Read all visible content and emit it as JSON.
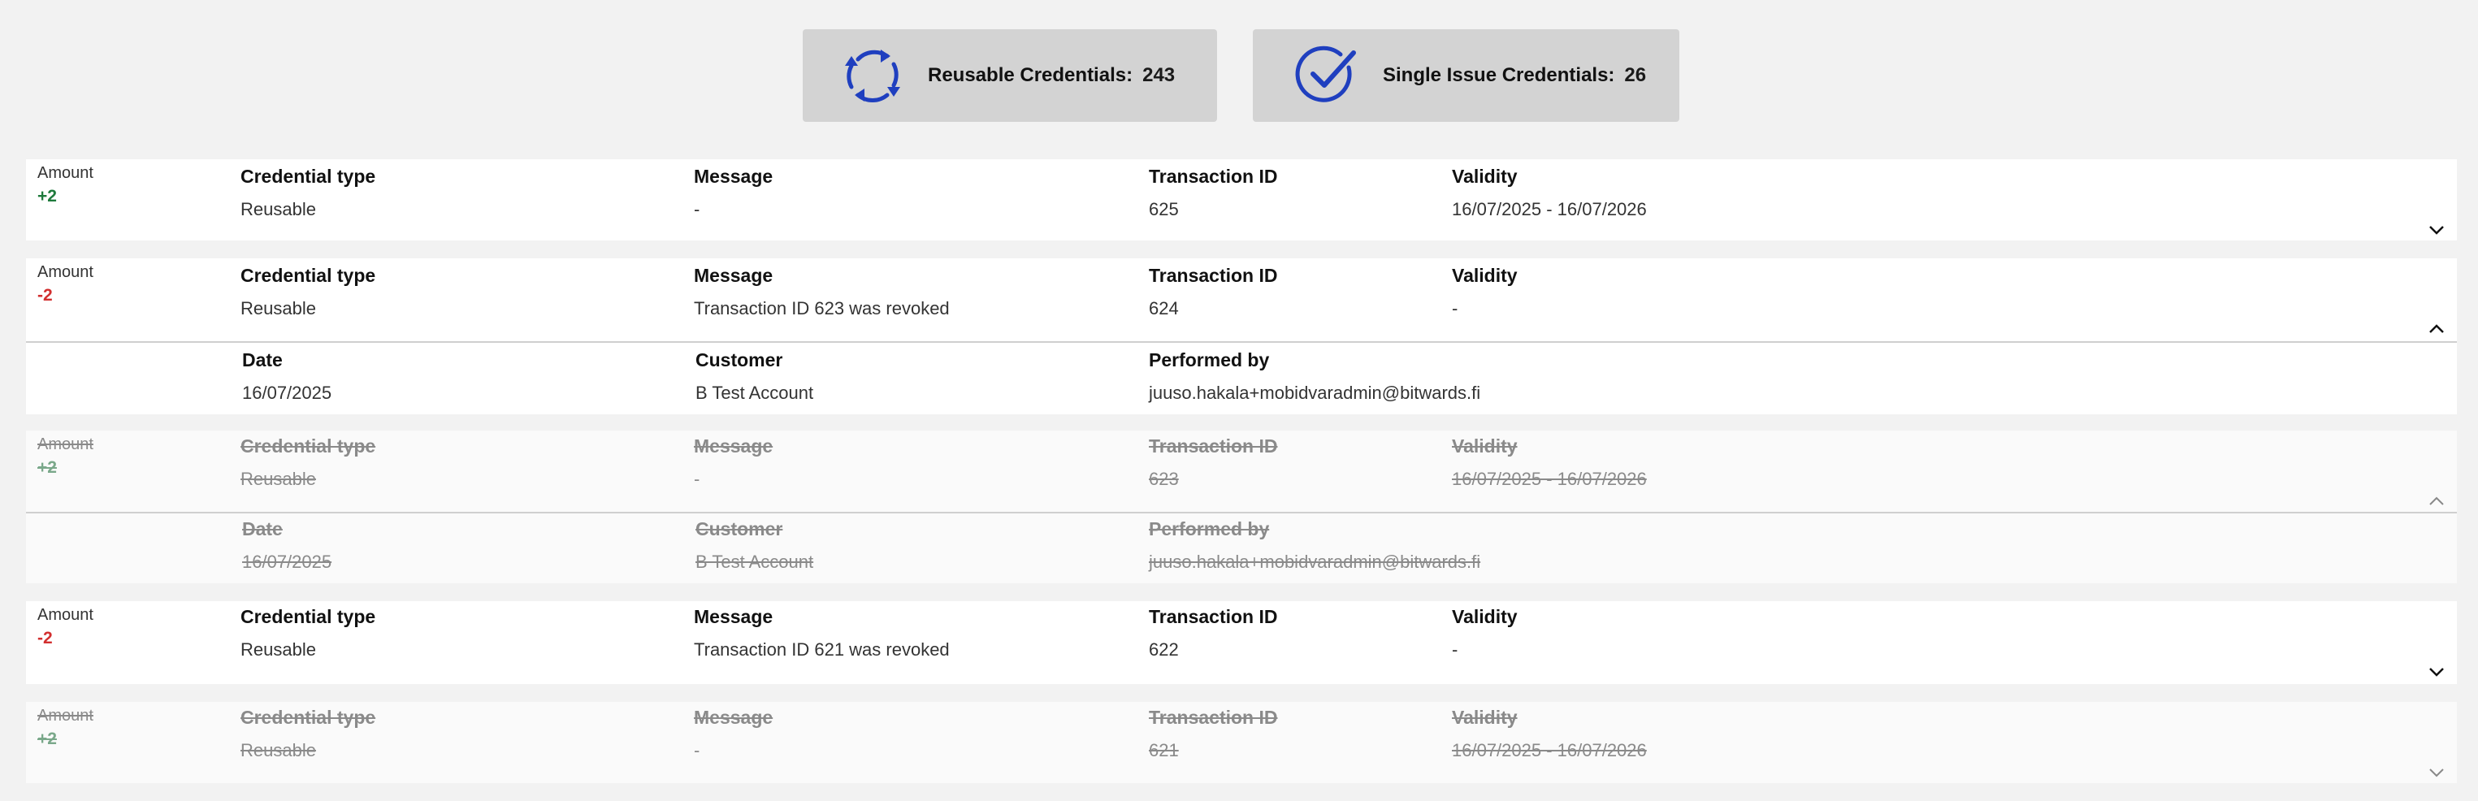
{
  "summary": {
    "reusable": {
      "label": "Reusable Credentials:",
      "count": "243",
      "icon": "refresh-cycle-icon"
    },
    "single": {
      "label": "Single Issue Credentials:",
      "count": "26",
      "icon": "check-circle-icon"
    },
    "accent_color": "#1f3fbf"
  },
  "headers": {
    "amount": "Amount",
    "credential_type": "Credential type",
    "message": "Message",
    "transaction_id": "Transaction ID",
    "validity": "Validity",
    "date": "Date",
    "customer": "Customer",
    "performed_by": "Performed by"
  },
  "transactions": [
    {
      "amount": "+2",
      "credential_type": "Reusable",
      "message": "-",
      "transaction_id": "625",
      "validity": "16/07/2025 - 16/07/2026",
      "expanded": false,
      "revoked": false
    },
    {
      "amount": "-2",
      "credential_type": "Reusable",
      "message": "Transaction ID 623 was revoked",
      "transaction_id": "624",
      "validity": "-",
      "expanded": true,
      "revoked": false,
      "details": {
        "date": "16/07/2025",
        "customer": "B Test Account",
        "performed_by": "juuso.hakala+mobidvaradmin@bitwards.fi"
      }
    },
    {
      "amount": "+2",
      "credential_type": "Reusable",
      "message": "-",
      "transaction_id": "623",
      "validity": "16/07/2025 - 16/07/2026",
      "expanded": true,
      "revoked": true,
      "details": {
        "date": "16/07/2025",
        "customer": "B Test Account",
        "performed_by": "juuso.hakala+mobidvaradmin@bitwards.fi"
      }
    },
    {
      "amount": "-2",
      "credential_type": "Reusable",
      "message": "Transaction ID 621 was revoked",
      "transaction_id": "622",
      "validity": "-",
      "expanded": false,
      "revoked": false
    },
    {
      "amount": "+2",
      "credential_type": "Reusable",
      "message": "-",
      "transaction_id": "621",
      "validity": "16/07/2025 - 16/07/2026",
      "expanded": false,
      "revoked": true
    }
  ],
  "colors": {
    "positive": "#1e7a3c",
    "negative": "#d22f2f"
  }
}
